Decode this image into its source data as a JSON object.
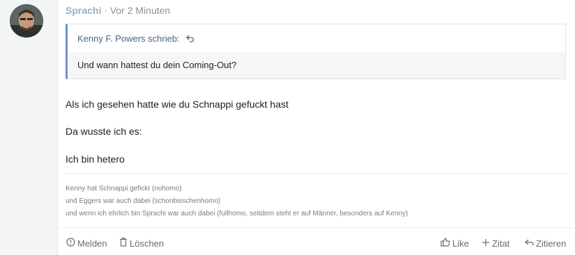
{
  "post": {
    "author": "Sprachi",
    "separator": "·",
    "time": "Vor 2 Minuten",
    "quote": {
      "author_line": "Kenny F. Powers schrieb:",
      "back_icon": "undo-icon",
      "text": "Und wann hattest du dein Coming-Out?"
    },
    "content": [
      "Als ich gesehen hatte wie du Schnappi gefuckt hast",
      "Da wusste ich es:",
      "Ich bin hetero"
    ],
    "signature": [
      "Kenny hat Schnappi gefickt (nohomo)",
      "und Eggers war auch dabei (schonbisschenhomo)",
      "und wenn ich ehrlich bin Sprachi war auch dabei (fullhomo, seitdem steht er auf Männer, besonders auf Kenny)"
    ],
    "actions": {
      "report": "Melden",
      "delete": "Löschen",
      "like": "Like",
      "quote_add": "Zitat",
      "cite": "Zitieren"
    }
  },
  "colors": {
    "author": "#93b0cf",
    "quote_border": "#6f93c8",
    "quote_author": "#47627f"
  }
}
